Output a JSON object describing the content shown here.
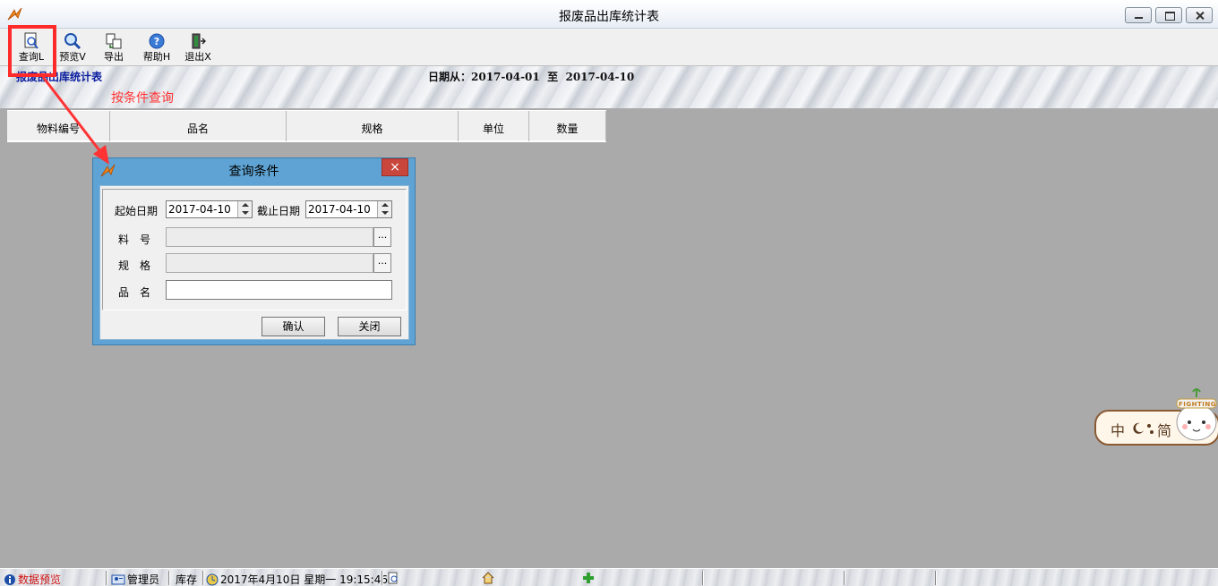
{
  "window": {
    "title": "报废品出库统计表"
  },
  "toolbar": {
    "items": [
      {
        "label": "查询L",
        "icon": "query-icon"
      },
      {
        "label": "预览V",
        "icon": "preview-icon"
      },
      {
        "label": "导出",
        "icon": "export-icon"
      },
      {
        "label": "帮助H",
        "icon": "help-icon"
      },
      {
        "label": "退出X",
        "icon": "exit-icon"
      }
    ]
  },
  "banner": {
    "title": "报废品出库统计表",
    "date_range": "日期从：2017-04-01  至  2017-04-10"
  },
  "annotation": {
    "text": "按条件查询",
    "color": "#ff3333"
  },
  "grid": {
    "columns": [
      "物料编号",
      "品名",
      "规格",
      "单位",
      "数量"
    ]
  },
  "dialog": {
    "title": "查询条件",
    "close_label": "×",
    "start_date_label": "起始日期",
    "start_date": "2017-04-10",
    "end_date_label": "截止日期",
    "end_date": "2017-04-10",
    "material_no_label": "料　号",
    "spec_label": "规　格",
    "name_label": "品　名",
    "browse_label": "...",
    "confirm_label": "确认",
    "close_button_label": "关闭"
  },
  "ime": {
    "lang": "中",
    "mode": "简",
    "mascot_text": "FIGHTING"
  },
  "statusbar": {
    "preview": "数据预览",
    "user": "管理员",
    "module": "库存",
    "datetime": "2017年4月10日 星期一 19:15:46"
  }
}
